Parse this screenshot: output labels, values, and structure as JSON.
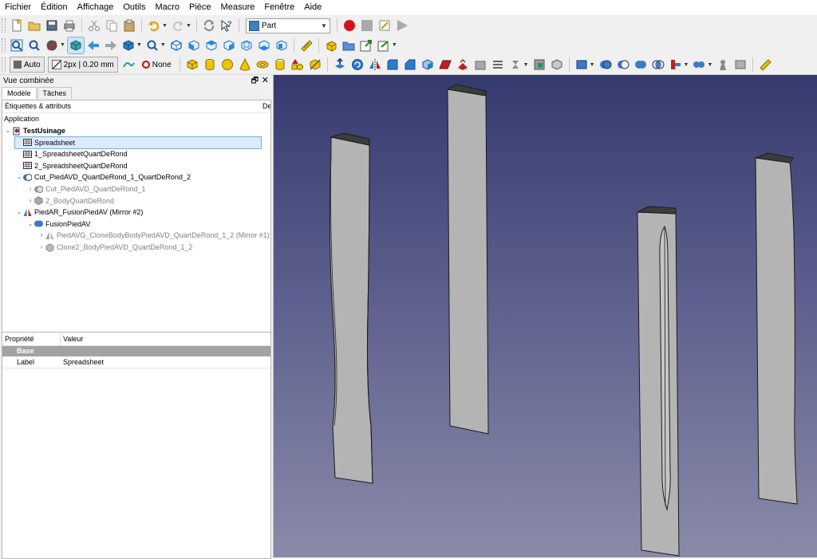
{
  "menu": [
    "Fichier",
    "Édition",
    "Affichage",
    "Outils",
    "Macro",
    "Pièce",
    "Measure",
    "Fenêtre",
    "Aide"
  ],
  "toolbar": {
    "workbench": "Part",
    "draw_style": "Auto",
    "line_width": "2px | 0.20 mm",
    "snap": "None"
  },
  "combo": {
    "title": "Vue combinée",
    "tabs": [
      "Modèle",
      "Tâches"
    ],
    "tree_col1": "Étiquettes & attributs",
    "tree_col2": "De"
  },
  "tree": {
    "application": "Application",
    "items": [
      {
        "label": "TestUsinage",
        "level": 0,
        "bold": true,
        "twisty": "open",
        "icon": "doc"
      },
      {
        "label": "Spreadsheet",
        "level": 1,
        "selected": true,
        "icon": "sheet"
      },
      {
        "label": "1_SpreadsheetQuartDeRond",
        "level": 1,
        "icon": "sheet"
      },
      {
        "label": "2_SpreadsheetQuartDeRond",
        "level": 1,
        "icon": "sheet"
      },
      {
        "label": "Cut_PiedAVD_QuartDeRond_1_QuartDeRond_2",
        "level": 1,
        "twisty": "open",
        "icon": "cut"
      },
      {
        "label": "Cut_PiedAVD_QuartDeRond_1",
        "level": 2,
        "grey": true,
        "twisty": "closed",
        "icon": "cut-grey"
      },
      {
        "label": "2_BodyQuartDeRond",
        "level": 2,
        "grey": true,
        "twisty": "closed",
        "icon": "body-grey"
      },
      {
        "label": "PiedAR_FusionPiedAV (Mirror #2)",
        "level": 1,
        "twisty": "open",
        "icon": "mirror"
      },
      {
        "label": "FusionPiedAV",
        "level": 2,
        "twisty": "open",
        "icon": "fusion"
      },
      {
        "label": "PiedAVG_CloneBodyBodyPiedAVD_QuartDeRond_1_2 (Mirror #1)",
        "level": 3,
        "grey": true,
        "twisty": "closed",
        "icon": "mirror-grey"
      },
      {
        "label": "Clone2_BodyPiedAVD_QuartDeRond_1_2",
        "level": 3,
        "grey": true,
        "twisty": "closed",
        "icon": "clone-grey"
      }
    ]
  },
  "properties": {
    "col_property": "Propriété",
    "col_value": "Valeur",
    "group": "Base",
    "row_key": "Label",
    "row_value": "Spreadsheet"
  },
  "colors": {
    "viewport_top": "#353a6e",
    "viewport_bottom": "#8a8aa8",
    "part_face": "#b4b4b4",
    "part_top": "#3c3c3c",
    "selection_bg": "#dcebfb"
  }
}
